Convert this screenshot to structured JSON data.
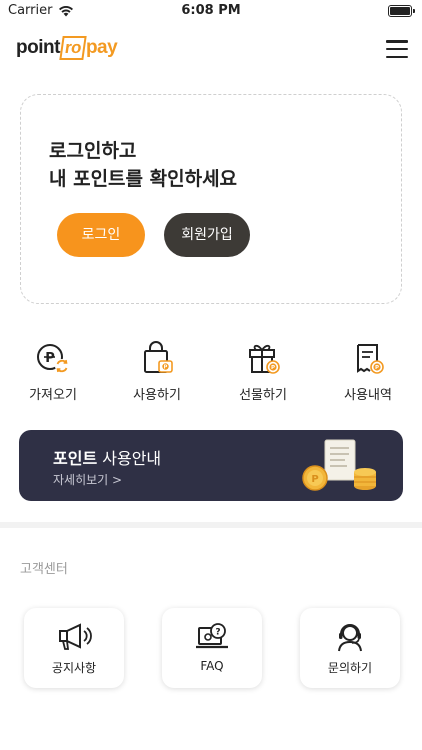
{
  "status_bar": {
    "carrier": "Carrier",
    "time": "6:08 PM"
  },
  "header": {
    "logo_parts": [
      "point",
      "ro",
      "pay"
    ],
    "menu_icon": "hamburger-menu-icon"
  },
  "login_card": {
    "title": "로그인하고\n내 포인트를 확인하세요",
    "login_label": "로그인",
    "signup_label": "회원가입",
    "accent": "#f7941d",
    "dark": "#3d3a36"
  },
  "quick_menu": [
    {
      "label": "가져오기",
      "icon": "point-import-icon"
    },
    {
      "label": "사용하기",
      "icon": "shopping-bag-icon"
    },
    {
      "label": "선물하기",
      "icon": "gift-icon"
    },
    {
      "label": "사용내역",
      "icon": "receipt-history-icon"
    }
  ],
  "banner": {
    "title_bold": "포인트",
    "title_rest": " 사용안내",
    "subtitle": "자세히보기 >",
    "background": "#2f3045"
  },
  "support": {
    "title": "고객센터",
    "items": [
      {
        "label": "공지사항",
        "icon": "megaphone-icon"
      },
      {
        "label": "FAQ",
        "icon": "faq-laptop-icon"
      },
      {
        "label": "문의하기",
        "icon": "headset-agent-icon"
      }
    ]
  }
}
